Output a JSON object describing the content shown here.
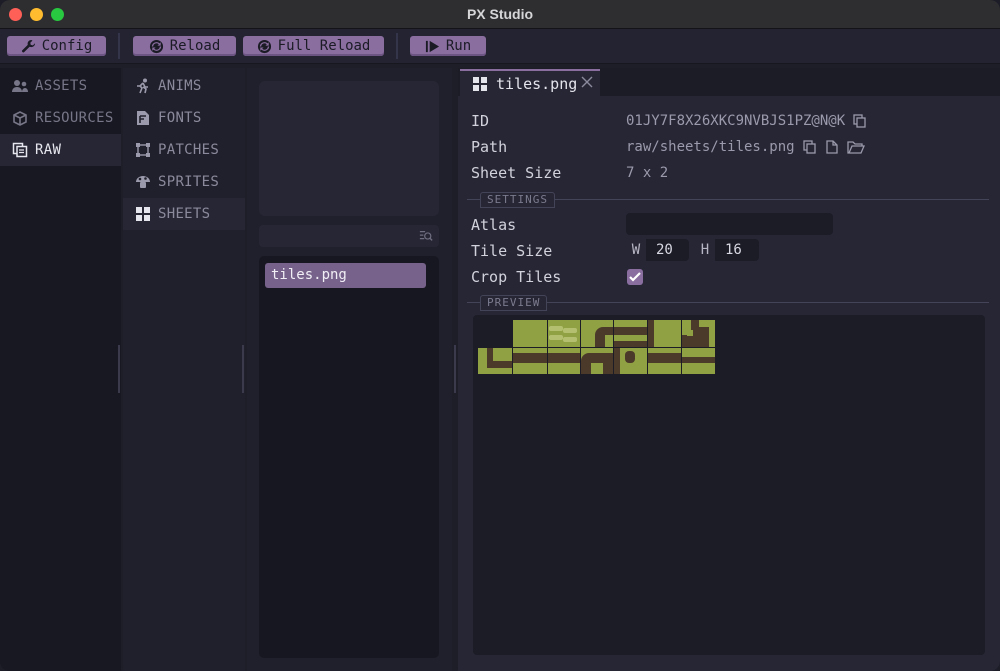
{
  "window": {
    "title": "PX Studio"
  },
  "toolbar": {
    "config_label": "Config",
    "reload_label": "Reload",
    "full_reload_label": "Full Reload",
    "run_label": "Run"
  },
  "sidebar": {
    "items": [
      {
        "label": "ASSETS",
        "icon": "users-icon"
      },
      {
        "label": "RESOURCES",
        "icon": "cube-icon"
      },
      {
        "label": "RAW",
        "icon": "copy-icon",
        "active": true
      }
    ]
  },
  "categories": {
    "items": [
      {
        "label": "ANIMS",
        "icon": "running-icon"
      },
      {
        "label": "FONTS",
        "icon": "font-file-icon"
      },
      {
        "label": "PATCHES",
        "icon": "patch-icon"
      },
      {
        "label": "SPRITES",
        "icon": "mushroom-icon"
      },
      {
        "label": "SHEETS",
        "icon": "grid-icon",
        "active": true
      }
    ]
  },
  "file_list": {
    "search_value": "",
    "items": [
      {
        "name": "tiles.png",
        "selected": true
      }
    ]
  },
  "editor": {
    "tab_label": "tiles.png",
    "props": {
      "id_label": "ID",
      "id_value": "01JY7F8X26XKC9NVBJS1PZ@N@K",
      "path_label": "Path",
      "path_value": "raw/sheets/tiles.png",
      "sheet_size_label": "Sheet Size",
      "sheet_size_value": "7 x 2"
    },
    "settings": {
      "section_label": "SETTINGS",
      "atlas_label": "Atlas",
      "atlas_value": "",
      "tile_size_label": "Tile Size",
      "w_key": "W",
      "w_value": "20",
      "h_key": "H",
      "h_value": "16",
      "crop_tiles_label": "Crop Tiles",
      "crop_tiles_checked": true
    },
    "preview": {
      "section_label": "PREVIEW"
    }
  },
  "colors": {
    "accent": "#8a6ea0",
    "tile_light": "#8fa142",
    "tile_dark": "#4b3a2a"
  }
}
